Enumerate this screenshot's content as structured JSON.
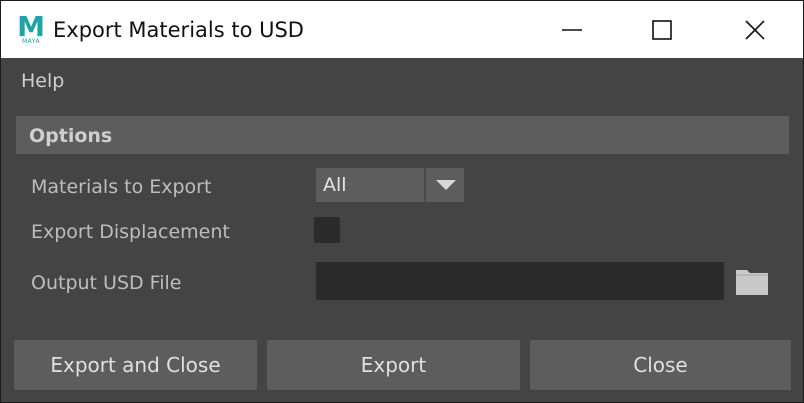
{
  "window": {
    "title": "Export Materials to USD",
    "app_icon_letter": "M",
    "app_icon_sub": "MAYA"
  },
  "menu": {
    "items": [
      "Help"
    ]
  },
  "options": {
    "section_label": "Options",
    "materials_label": "Materials to Export",
    "materials_value": "All",
    "displacement_label": "Export Displacement",
    "displacement_checked": false,
    "output_label": "Output USD File",
    "output_value": ""
  },
  "buttons": {
    "export_and_close": "Export and Close",
    "export": "Export",
    "close": "Close"
  },
  "colors": {
    "background": "#444444",
    "panel": "#5d5d5d",
    "field": "#2b2b2b",
    "maya_teal": "#1fa3a6"
  }
}
